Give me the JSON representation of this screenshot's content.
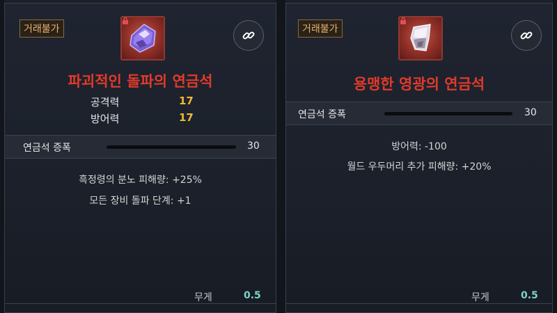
{
  "cards": [
    {
      "badge": "거래불가",
      "name": "파괴적인 돌파의 연금석",
      "icon": "purple-crystal-icon",
      "stats": [
        {
          "label": "공격력",
          "value": "17"
        },
        {
          "label": "방어력",
          "value": "17"
        }
      ],
      "amplification_label": "연금석 증폭",
      "amplification_value": "30",
      "effects": [
        "흑정령의 분노 피해량: +25%",
        "모든 장비 돌파 단계: +1"
      ],
      "weight_label": "무게",
      "weight_value": "0.5"
    },
    {
      "badge": "거래불가",
      "name": "용맹한 영광의 연금석",
      "icon": "white-crystal-icon",
      "stats": [],
      "amplification_label": "연금석 증폭",
      "amplification_value": "30",
      "effects": [
        "방어력: -100",
        "월드 우두머리 추가 피해량: +20%"
      ],
      "weight_label": "무게",
      "weight_value": "0.5"
    }
  ],
  "colors": {
    "item_name": "#e23a2a",
    "stat_value": "#f0b838",
    "weight_value": "#7fd1c8",
    "badge_text": "#e8b26a"
  }
}
